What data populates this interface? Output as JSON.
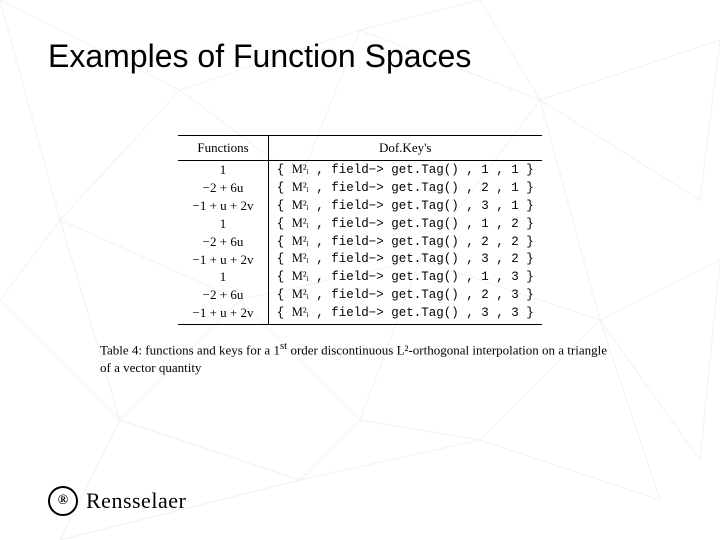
{
  "title": "Examples of Function Spaces",
  "table": {
    "headers": {
      "functions": "Functions",
      "dofkeys": "Dof.Key's"
    },
    "rows": [
      {
        "func": "1",
        "key": {
          "mi": "M²ᵢ",
          "call": "field−> get.Tag()",
          "a": "1",
          "b": "1"
        }
      },
      {
        "func": "−2 + 6u",
        "key": {
          "mi": "M²ᵢ",
          "call": "field−> get.Tag()",
          "a": "2",
          "b": "1"
        }
      },
      {
        "func": "−1 + u + 2v",
        "key": {
          "mi": "M²ᵢ",
          "call": "field−> get.Tag()",
          "a": "3",
          "b": "1"
        }
      },
      {
        "func": "1",
        "key": {
          "mi": "M²ᵢ",
          "call": "field−> get.Tag()",
          "a": "1",
          "b": "2"
        }
      },
      {
        "func": "−2 + 6u",
        "key": {
          "mi": "M²ᵢ",
          "call": "field−> get.Tag()",
          "a": "2",
          "b": "2"
        }
      },
      {
        "func": "−1 + u + 2v",
        "key": {
          "mi": "M²ᵢ",
          "call": "field−> get.Tag()",
          "a": "3",
          "b": "2"
        }
      },
      {
        "func": "1",
        "key": {
          "mi": "M²ᵢ",
          "call": "field−> get.Tag()",
          "a": "1",
          "b": "3"
        }
      },
      {
        "func": "−2 + 6u",
        "key": {
          "mi": "M²ᵢ",
          "call": "field−> get.Tag()",
          "a": "2",
          "b": "3"
        }
      },
      {
        "func": "−1 + u + 2v",
        "key": {
          "mi": "M²ᵢ",
          "call": "field−> get.Tag()",
          "a": "3",
          "b": "3"
        }
      }
    ]
  },
  "caption_prefix": "Table 4: functions and keys for a 1",
  "caption_sup": "st",
  "caption_suffix": " order discontinuous L²-orthogonal interpolation on a triangle of a vector quantity",
  "logo": {
    "seal_glyph": "®",
    "text": "Rensselaer"
  }
}
